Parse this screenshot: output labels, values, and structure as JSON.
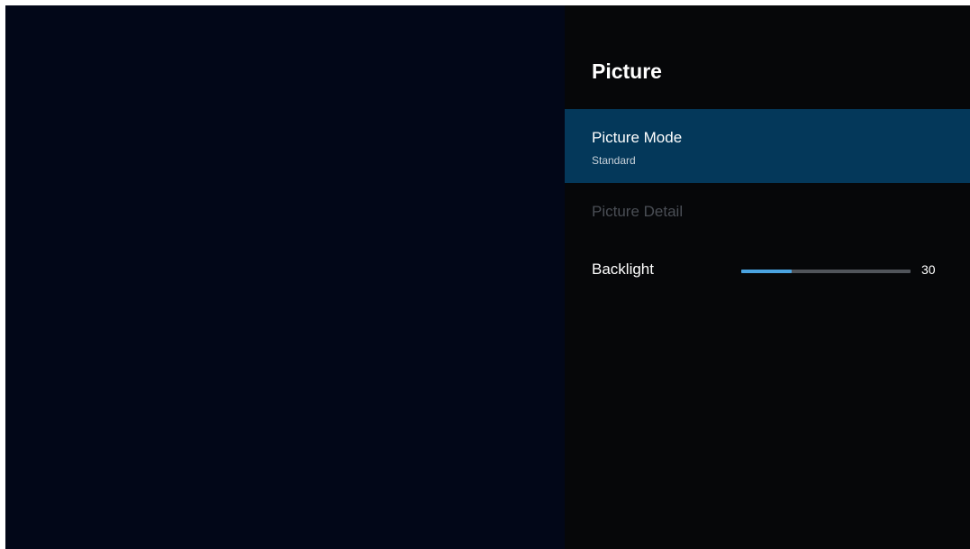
{
  "panel": {
    "title": "Picture",
    "items": [
      {
        "label": "Picture Mode",
        "value": "Standard",
        "state": "selected"
      },
      {
        "label": "Picture Detail",
        "state": "disabled"
      },
      {
        "label": "Backlight",
        "value": "30",
        "level": 0.3
      }
    ]
  },
  "colors": {
    "background": "#020718",
    "panel": "#060709",
    "selected": "#04385a",
    "slider_fill": "#4aa3e0",
    "slider_track": "#50545a"
  }
}
